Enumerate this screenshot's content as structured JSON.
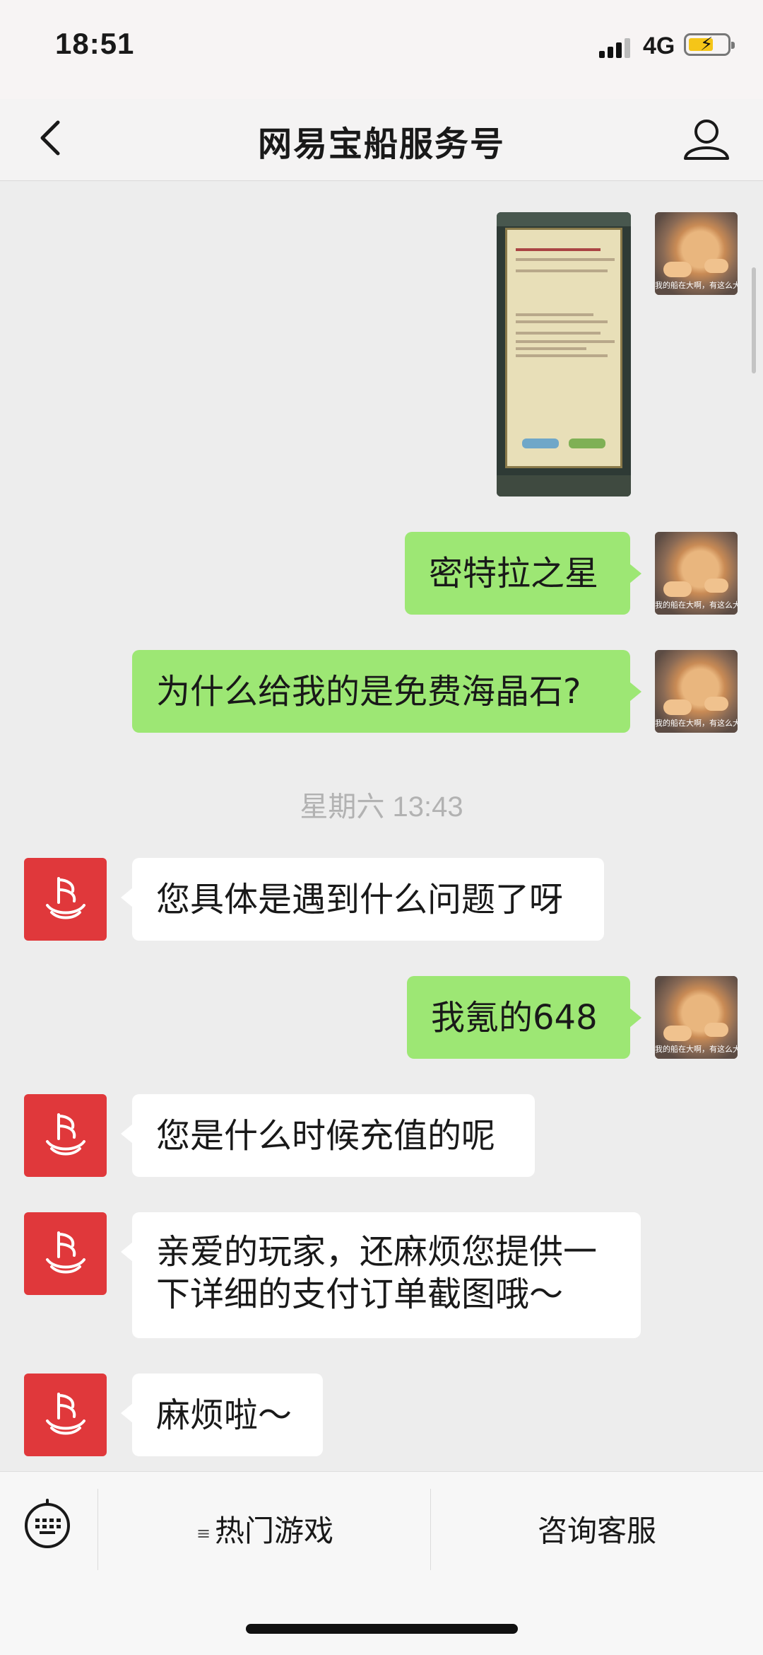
{
  "status_bar": {
    "time": "18:51",
    "network": "4G"
  },
  "nav": {
    "title": "网易宝船服务号"
  },
  "messages": {
    "m1": "密特拉之星",
    "m2": "为什么给我的是免费海晶石?",
    "timestamp": "星期六 13:43",
    "m3": "您具体是遇到什么问题了呀",
    "m4": "我氪的648",
    "m5": "您是什么时候充值的呢",
    "m6_line1": "亲爱的玩家，还麻烦您提供一",
    "m6_line2": "下详细的支付订单截图哦～",
    "m7": "麻烦啦～"
  },
  "bottom_bar": {
    "menu_1": "热门游戏",
    "menu_2": "咨询客服"
  },
  "colors": {
    "my_bubble": "#9de774",
    "their_bubble": "#ffffff",
    "brand_red": "#e0383b",
    "background": "#ededed"
  },
  "icons": [
    "back-chevron-icon",
    "person-icon",
    "keyboard-icon",
    "menu-list-icon",
    "netease-ship-logo-icon"
  ]
}
